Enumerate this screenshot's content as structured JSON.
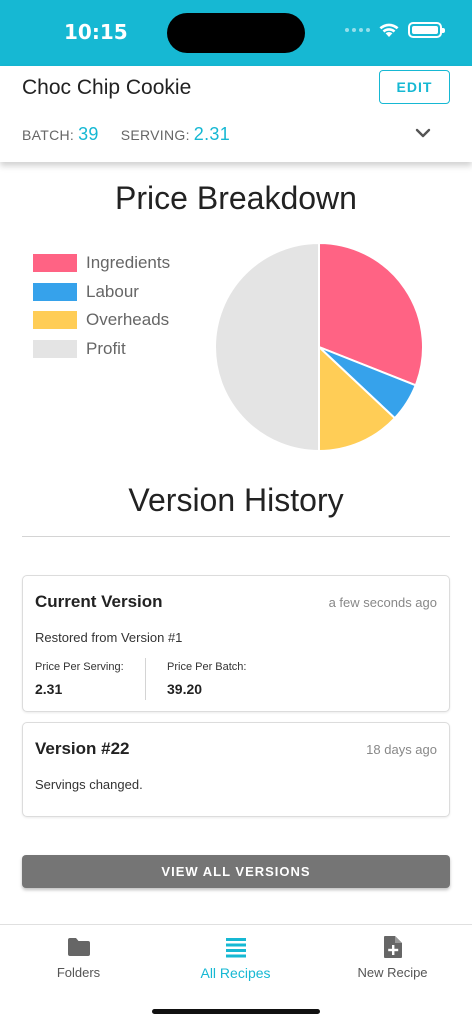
{
  "status_bar": {
    "time": "10:15",
    "icons": [
      "cellular-icon",
      "wifi-icon",
      "battery-icon"
    ],
    "color": "#16b8d3"
  },
  "header": {
    "title": "Choc Chip Cookie",
    "edit_label": "EDIT",
    "batch_label": "BATCH:",
    "batch_value": "39",
    "serving_label": "SERVING:",
    "serving_value": "2.31",
    "expand_icon": "chevron-down-icon"
  },
  "price_breakdown": {
    "title": "Price Breakdown",
    "legend": [
      {
        "label": "Ingredients",
        "color": "#ff6384"
      },
      {
        "label": "Labour",
        "color": "#36a2eb"
      },
      {
        "label": "Overheads",
        "color": "#ffcd56"
      },
      {
        "label": "Profit",
        "color": "#e4e4e4"
      }
    ],
    "chart_data": {
      "type": "pie",
      "categories": [
        "Ingredients",
        "Labour",
        "Overheads",
        "Profit"
      ],
      "values": [
        31,
        6,
        13,
        50
      ]
    }
  },
  "version_history": {
    "title": "Version History",
    "versions": [
      {
        "title": "Current Version",
        "time": "a few seconds ago",
        "description": "Restored from Version #1",
        "price_per_serving_label": "Price Per Serving:",
        "price_per_serving": "2.31",
        "price_per_batch_label": "Price Per Batch:",
        "price_per_batch": "39.20"
      },
      {
        "title": "Version #22",
        "time": "18 days ago",
        "description": "Servings changed."
      }
    ],
    "view_all_label": "VIEW ALL VERSIONS"
  },
  "tab_bar": {
    "tabs": [
      {
        "label": "Folders",
        "icon": "folder-icon",
        "active": false
      },
      {
        "label": "All Recipes",
        "icon": "list-icon",
        "active": true
      },
      {
        "label": "New Recipe",
        "icon": "new-document-icon",
        "active": false
      }
    ],
    "active_color": "#16b8d3"
  }
}
